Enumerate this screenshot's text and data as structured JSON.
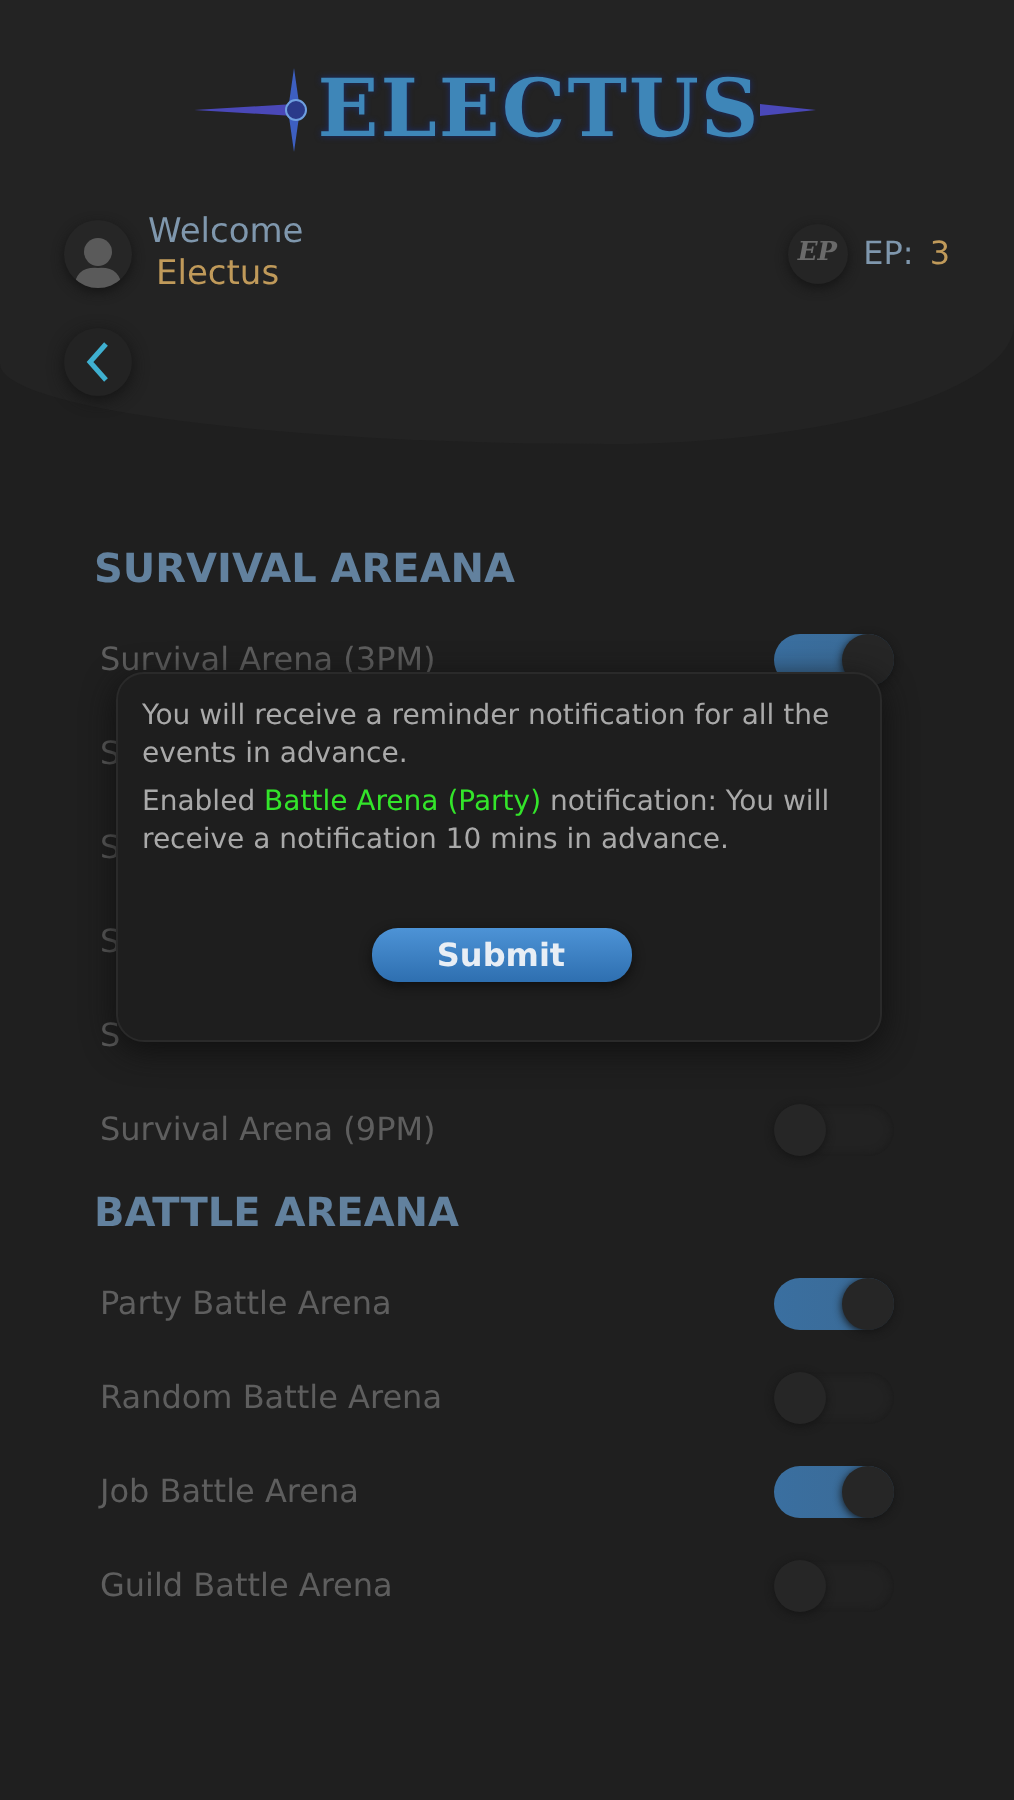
{
  "logo": {
    "text": "ELECTUS"
  },
  "user": {
    "greeting": "Welcome",
    "name": "Electus"
  },
  "points": {
    "badge": "EP",
    "label": "EP:",
    "value": "3"
  },
  "sections": [
    {
      "title": "SURVIVAL AREANA",
      "items": [
        {
          "label": "Survival Arena (3PM)",
          "on": true
        },
        {
          "label": "S"
        },
        {
          "label": "S"
        },
        {
          "label": "S"
        },
        {
          "label": "S"
        },
        {
          "label": "Survival Arena (9PM)",
          "on": false
        }
      ]
    },
    {
      "title": "BATTLE AREANA",
      "items": [
        {
          "label": "Party Battle Arena",
          "on": true
        },
        {
          "label": "Random Battle Arena",
          "on": false
        },
        {
          "label": "Job Battle Arena",
          "on": true
        },
        {
          "label": "Guild Battle Arena",
          "on": false
        }
      ]
    }
  ],
  "dialog": {
    "message": "You will receive a reminder notification for all the events in advance.",
    "detail": "Enabled **Battle Arena (Party)** notification: You will receive a notification 10 mins in advance.",
    "button": "Submit"
  }
}
